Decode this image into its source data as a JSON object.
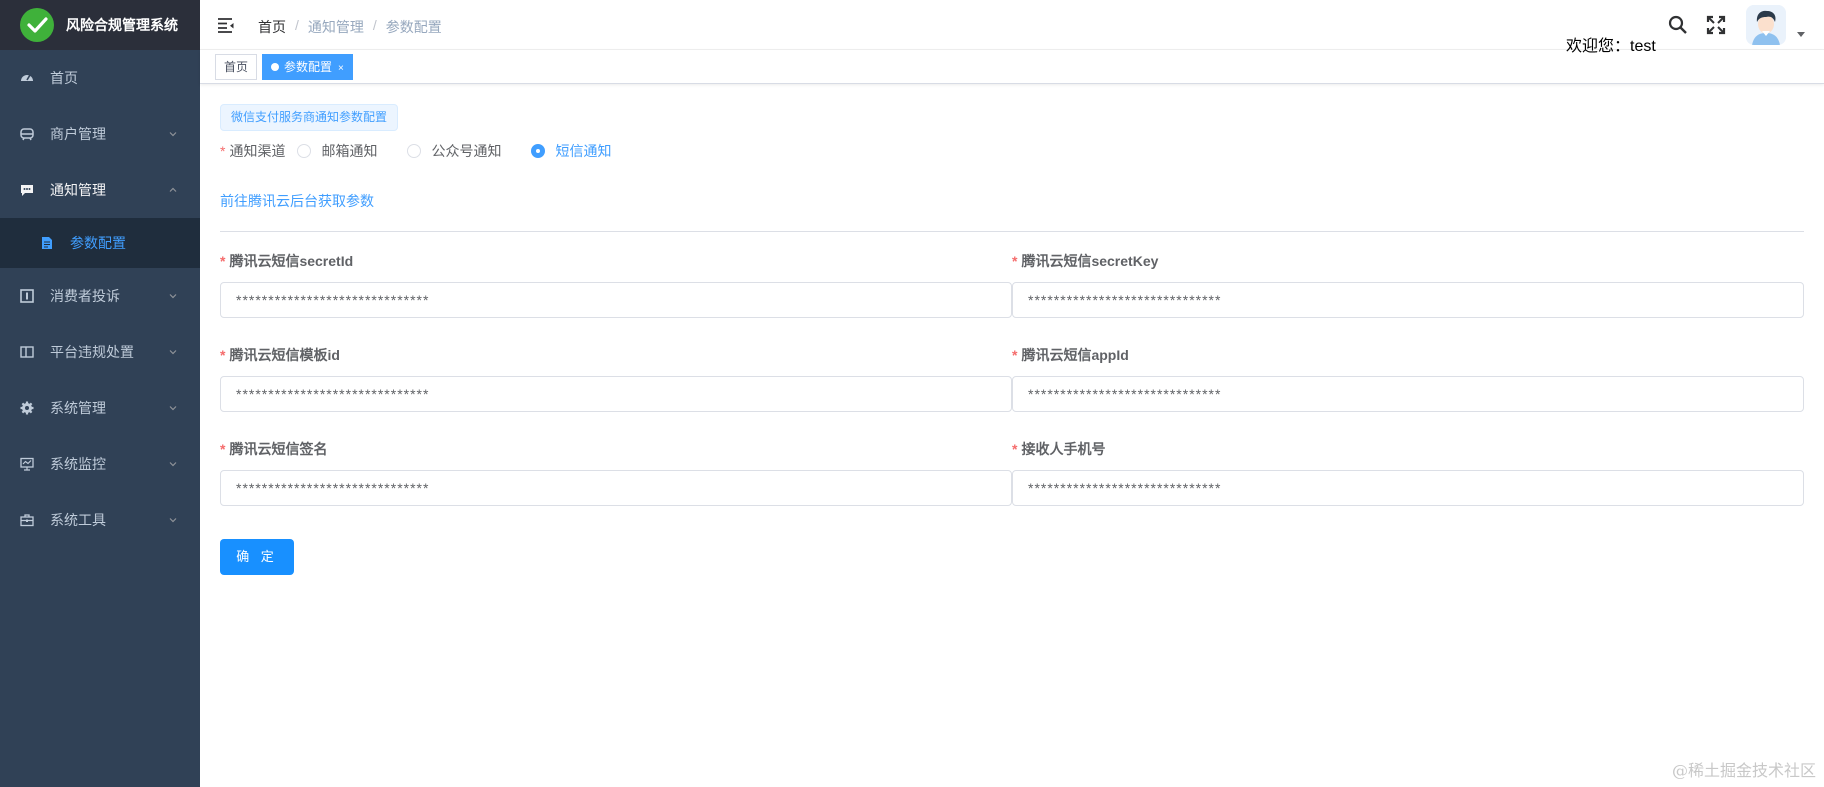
{
  "app": {
    "title": "风险合规管理系统",
    "brand_color": "#3fb13a"
  },
  "sidebar": {
    "items": [
      {
        "label": "首页",
        "icon": "dashboard-icon",
        "expandable": false
      },
      {
        "label": "商户管理",
        "icon": "merchant-icon",
        "expandable": true
      },
      {
        "label": "通知管理",
        "icon": "message-icon",
        "expandable": true,
        "open": true,
        "children": [
          {
            "label": "参数配置",
            "icon": "document-icon",
            "active": true
          }
        ]
      },
      {
        "label": "消费者投诉",
        "icon": "complaint-icon",
        "expandable": true
      },
      {
        "label": "平台违规处置",
        "icon": "panel-icon",
        "expandable": true
      },
      {
        "label": "系统管理",
        "icon": "gear-icon",
        "expandable": true
      },
      {
        "label": "系统监控",
        "icon": "monitor-icon",
        "expandable": true
      },
      {
        "label": "系统工具",
        "icon": "toolbox-icon",
        "expandable": true
      }
    ]
  },
  "navbar": {
    "breadcrumb": [
      "首页",
      "通知管理",
      "参数配置"
    ],
    "welcome": "欢迎您：test"
  },
  "tags_view": {
    "tabs": [
      {
        "label": "首页",
        "active": false
      },
      {
        "label": "参数配置",
        "active": true,
        "close": "×"
      }
    ]
  },
  "form": {
    "info_tag": "微信支付服务商通知参数配置",
    "channel": {
      "label": "通知渠道",
      "options": [
        {
          "label": "邮箱通知",
          "checked": false
        },
        {
          "label": "公众号通知",
          "checked": false
        },
        {
          "label": "短信通知",
          "checked": true
        }
      ]
    },
    "link": "前往腾讯云后台获取参数",
    "fields": [
      {
        "label": "腾讯云短信secretId",
        "value": "******************************"
      },
      {
        "label": "腾讯云短信secretKey",
        "value": "******************************"
      },
      {
        "label": "腾讯云短信模板id",
        "value": "******************************"
      },
      {
        "label": "腾讯云短信appId",
        "value": "******************************"
      },
      {
        "label": "腾讯云短信签名",
        "value": "******************************"
      },
      {
        "label": "接收人手机号",
        "value": "******************************"
      }
    ],
    "submit_label": "确 定"
  },
  "watermark": "@稀土掘金技术社区",
  "colors": {
    "sidebar_bg": "#304156",
    "accent": "#409eff",
    "required": "#f56c6c"
  }
}
